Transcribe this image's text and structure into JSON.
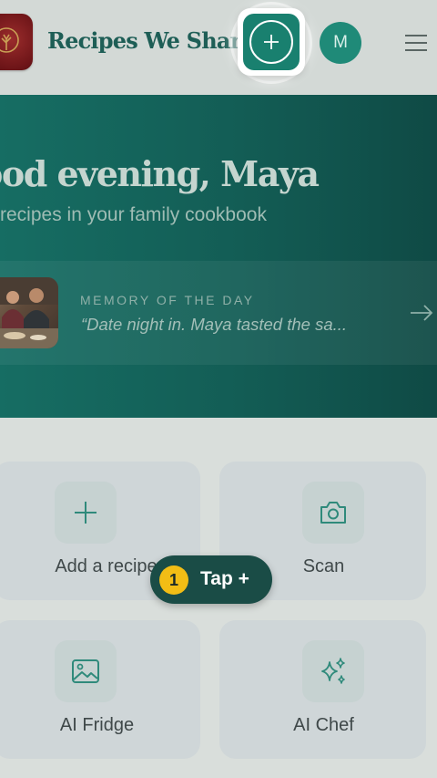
{
  "header": {
    "app_title": "Recipes We Share",
    "avatar_initial": "M"
  },
  "hero": {
    "greeting": "ood evening, Maya",
    "subtitle": "recipes in your family cookbook",
    "memory": {
      "label": "MEMORY OF THE DAY",
      "quote": "“Date night in. Maya tasted the sa..."
    }
  },
  "actions": [
    {
      "label": "Add a recipe",
      "icon": "plus-icon"
    },
    {
      "label": "Scan",
      "icon": "camera-icon"
    },
    {
      "label": "AI Fridge",
      "icon": "image-icon"
    },
    {
      "label": "AI Chef",
      "icon": "sparkles-icon"
    }
  ],
  "tooltip": {
    "step": "1",
    "text": "Tap +"
  },
  "colors": {
    "accent": "#19806f",
    "hero": "#135d55",
    "tooltip": "#1a4c46",
    "step_badge": "#f2bd15"
  }
}
